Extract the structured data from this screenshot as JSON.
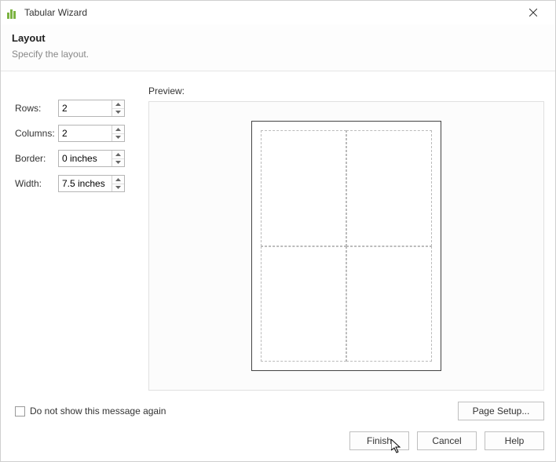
{
  "window": {
    "title": "Tabular Wizard"
  },
  "header": {
    "heading": "Layout",
    "subheading": "Specify the layout."
  },
  "form": {
    "rows": {
      "label": "Rows:",
      "value": "2"
    },
    "columns": {
      "label": "Columns:",
      "value": "2"
    },
    "border": {
      "label": "Border:",
      "value": "0 inches"
    },
    "width": {
      "label": "Width:",
      "value": "7.5 inches"
    }
  },
  "preview": {
    "label": "Preview:"
  },
  "checkbox": {
    "label": "Do not show this message again",
    "checked": false
  },
  "buttons": {
    "page_setup": "Page Setup...",
    "finish": "Finish",
    "cancel": "Cancel",
    "help": "Help"
  }
}
